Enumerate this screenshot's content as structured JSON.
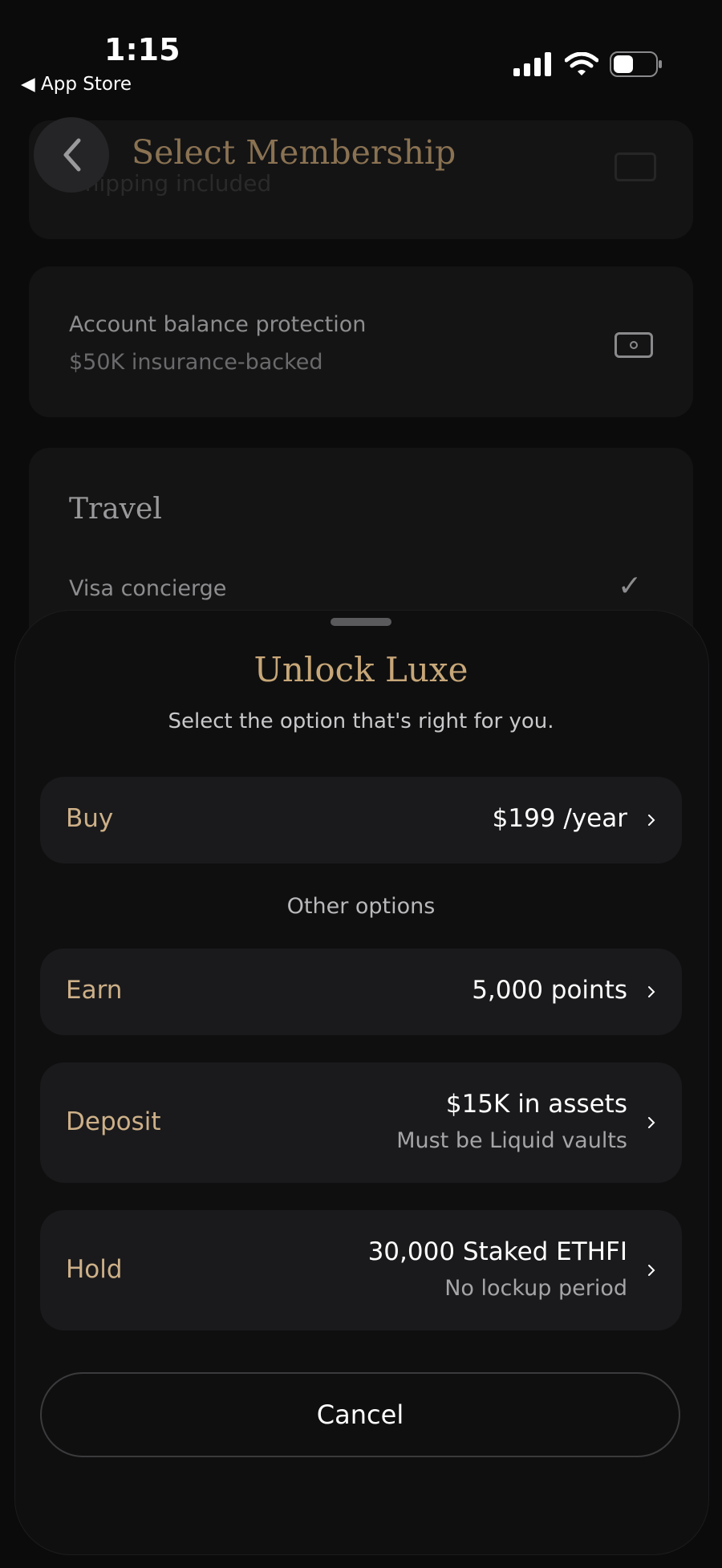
{
  "status_bar": {
    "time": "1:15",
    "back_app": "◀ App Store"
  },
  "header": {
    "title": "Select Membership"
  },
  "background": {
    "faded_text": "Shipping included",
    "protection": {
      "title": "Account balance protection",
      "subtitle": "$50K insurance-backed"
    },
    "travel": {
      "title": "Travel",
      "item": "Visa concierge",
      "check": "✓"
    }
  },
  "sheet": {
    "title": "Unlock Luxe",
    "subtitle": "Select the option that's right for you.",
    "other_options_label": "Other options",
    "options": [
      {
        "label": "Buy",
        "value": "$199 /year",
        "note": ""
      },
      {
        "label": "Earn",
        "value": "5,000 points",
        "note": ""
      },
      {
        "label": "Deposit",
        "value": "$15K in assets",
        "note": "Must be Liquid vaults"
      },
      {
        "label": "Hold",
        "value": "30,000 Staked ETHFI",
        "note": "No lockup period"
      }
    ],
    "cancel_label": "Cancel"
  },
  "colors": {
    "accent_gold": "#c7a778",
    "background": "#0b0b0c",
    "card": "#1a1a1c"
  }
}
